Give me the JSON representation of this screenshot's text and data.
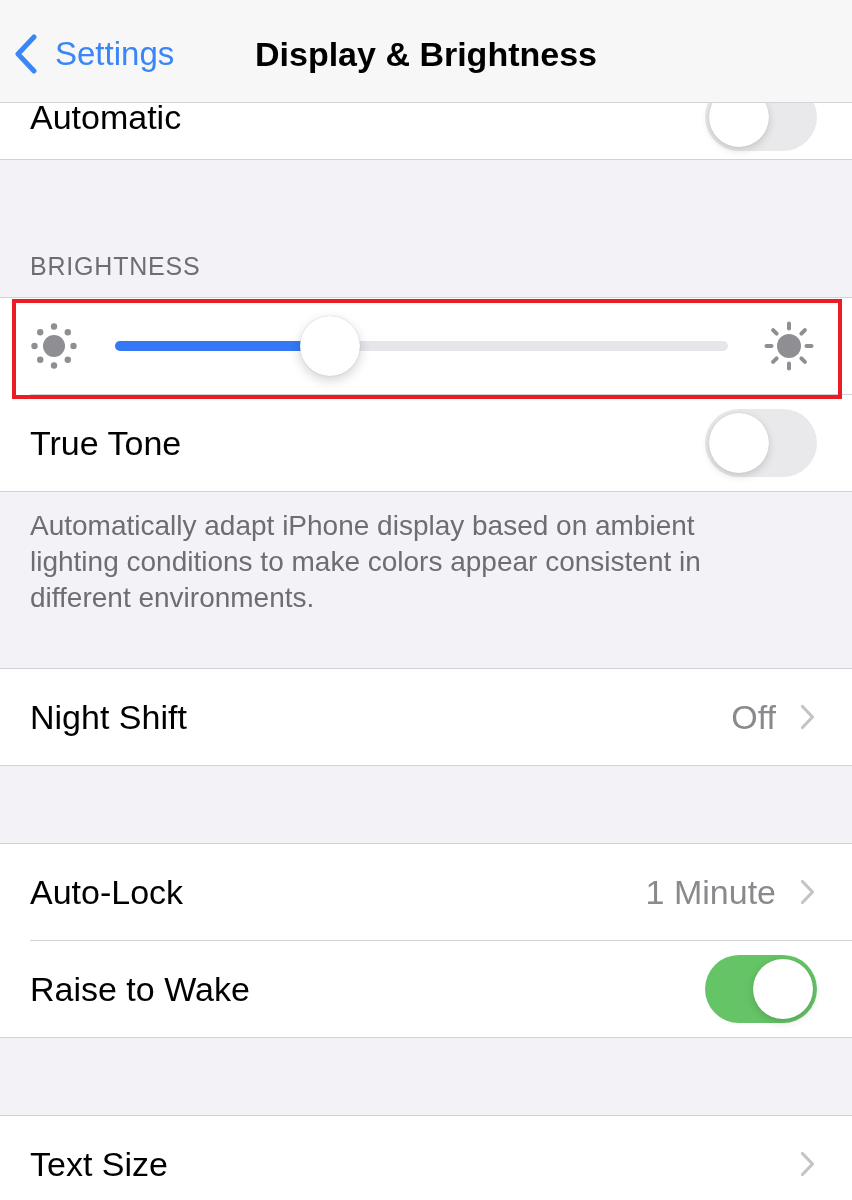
{
  "nav_bar": {
    "back_label": "Settings",
    "title": "Display & Brightness"
  },
  "sections": [
    {
      "rows": [
        {
          "kind": "toggle",
          "label": "Automatic",
          "on": false
        }
      ]
    },
    {
      "header": "BRIGHTNESS",
      "rows": [
        {
          "kind": "slider",
          "level": 0.35,
          "highlighted": true
        },
        {
          "kind": "toggle",
          "label": "True Tone",
          "on": false
        }
      ],
      "footer": "Automatically adapt iPhone display based on ambient lighting conditions to make colors appear consistent in different environments."
    },
    {
      "rows": [
        {
          "kind": "link",
          "label": "Night Shift",
          "value": "Off"
        }
      ]
    },
    {
      "rows": [
        {
          "kind": "link",
          "label": "Auto-Lock",
          "value": "1 Minute"
        },
        {
          "kind": "toggle",
          "label": "Raise to Wake",
          "on": true
        }
      ]
    },
    {
      "rows": [
        {
          "kind": "link",
          "label": "Text Size"
        }
      ]
    }
  ]
}
